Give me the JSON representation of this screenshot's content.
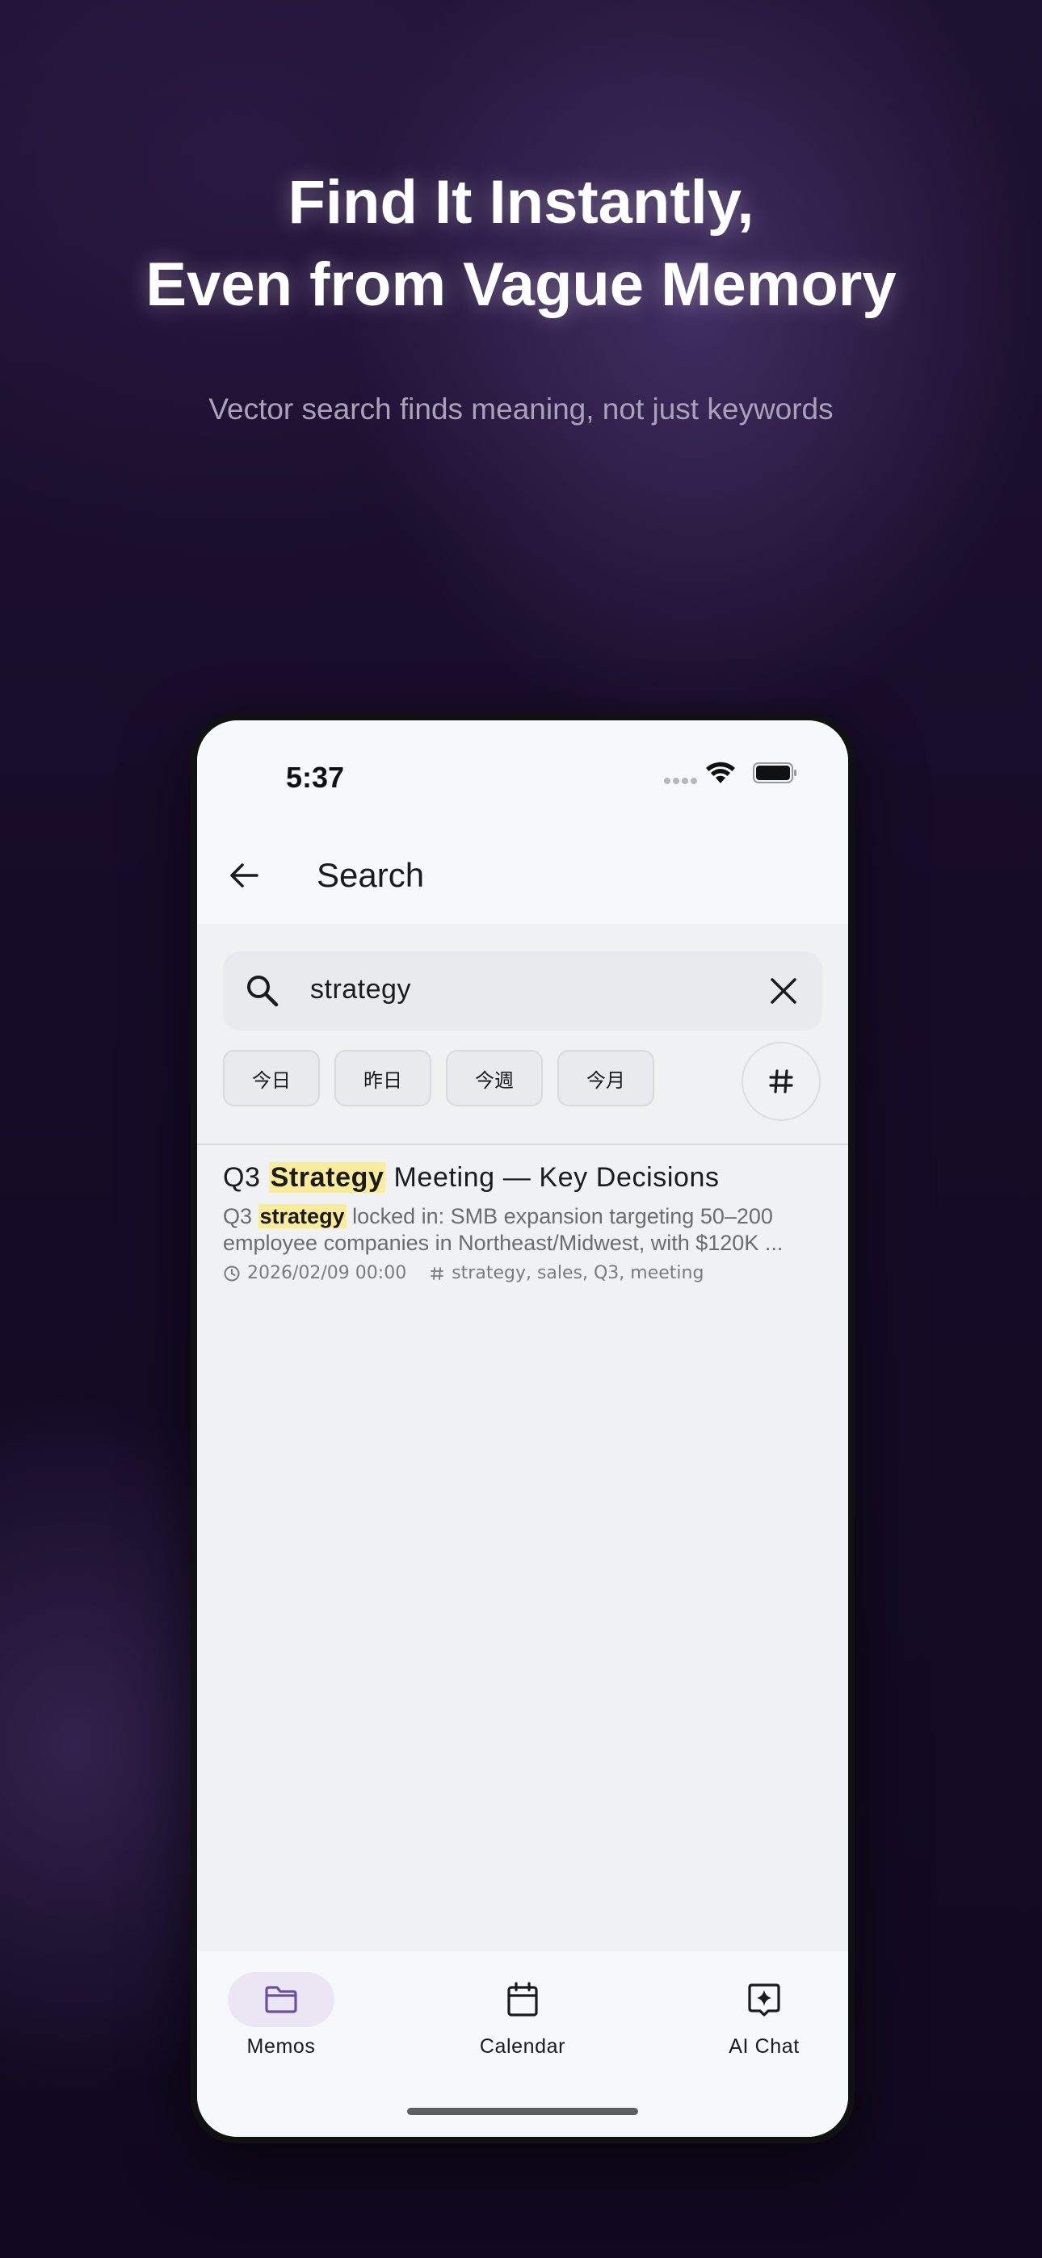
{
  "headline": {
    "line1": "Find It Instantly,",
    "line2": "Even from Vague Memory",
    "subtitle": "Vector search finds meaning, not just keywords"
  },
  "status_bar": {
    "time": "5:37",
    "icons": [
      "signal-dots-icon",
      "wifi-icon",
      "battery-icon"
    ]
  },
  "app_bar": {
    "back_icon": "arrow-left-icon",
    "title": "Search"
  },
  "search": {
    "value": "strategy",
    "icon": "search-icon",
    "clear_icon": "close-icon"
  },
  "date_chips": [
    "今日",
    "昨日",
    "今週",
    "今月"
  ],
  "tag_filter_icon": "hash-icon",
  "results": [
    {
      "title_prefix": "Q3 ",
      "title_match": "Strategy",
      "title_suffix": " Meeting — Key Decisions",
      "snippet_prefix": "Q3 ",
      "snippet_match": "strategy",
      "snippet_suffix": " locked in: SMB expansion targeting 50–200 employee companies in Northeast/Midwest, with $120K ...",
      "date": "2026/02/09 00:00",
      "tags": "strategy, sales, Q3, meeting"
    }
  ],
  "bottom_nav": [
    {
      "label": "Memos",
      "icon": "folder-icon",
      "active": true
    },
    {
      "label": "Calendar",
      "icon": "calendar-icon",
      "active": false
    },
    {
      "label": "AI Chat",
      "icon": "ai-sparkle-icon",
      "active": false
    }
  ],
  "colors": {
    "accent": "#6a4fa3",
    "highlight": "#f9ed9b",
    "active_nav_bg": "#ece6f4",
    "background": "#140b22"
  }
}
